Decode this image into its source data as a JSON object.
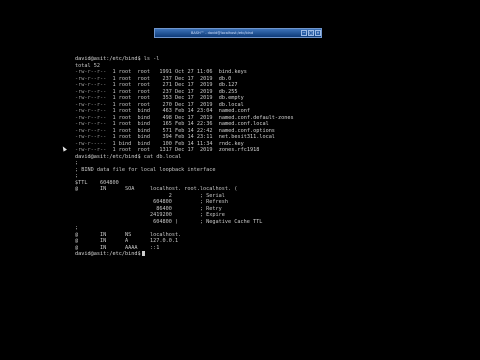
{
  "window": {
    "title": "BASH™ - david@localhost:/etc/bind",
    "controls": [
      "minimize",
      "maximize",
      "close"
    ]
  },
  "terminal": {
    "prompt": "david@asit:/etc/bind$",
    "cmd1": "ls -l",
    "total": "total 52",
    "ls": [
      {
        "perm": "-rw-r--r--",
        "links": "1",
        "owner": "root",
        "group": "root",
        "size": "1991",
        "date": "Oct 27 11:06",
        "name": "bind.keys"
      },
      {
        "perm": "-rw-r--r--",
        "links": "1",
        "owner": "root",
        "group": "root",
        "size": "237",
        "date": "Dec 17  2019",
        "name": "db.0"
      },
      {
        "perm": "-rw-r--r--",
        "links": "1",
        "owner": "root",
        "group": "root",
        "size": "271",
        "date": "Dec 17  2019",
        "name": "db.127"
      },
      {
        "perm": "-rw-r--r--",
        "links": "1",
        "owner": "root",
        "group": "root",
        "size": "237",
        "date": "Dec 17  2019",
        "name": "db.255"
      },
      {
        "perm": "-rw-r--r--",
        "links": "1",
        "owner": "root",
        "group": "root",
        "size": "353",
        "date": "Dec 17  2019",
        "name": "db.empty"
      },
      {
        "perm": "-rw-r--r--",
        "links": "1",
        "owner": "root",
        "group": "root",
        "size": "270",
        "date": "Dec 17  2019",
        "name": "db.local"
      },
      {
        "perm": "-rw-r--r--",
        "links": "1",
        "owner": "root",
        "group": "bind",
        "size": "463",
        "date": "Feb 14 23:04",
        "name": "named.conf"
      },
      {
        "perm": "-rw-r--r--",
        "links": "1",
        "owner": "root",
        "group": "bind",
        "size": "498",
        "date": "Dec 17  2019",
        "name": "named.conf.default-zones"
      },
      {
        "perm": "-rw-r--r--",
        "links": "1",
        "owner": "root",
        "group": "bind",
        "size": "165",
        "date": "Feb 14 22:36",
        "name": "named.conf.local"
      },
      {
        "perm": "-rw-r--r--",
        "links": "1",
        "owner": "root",
        "group": "bind",
        "size": "571",
        "date": "Feb 14 22:42",
        "name": "named.conf.options"
      },
      {
        "perm": "-rw-r--r--",
        "links": "1",
        "owner": "root",
        "group": "bind",
        "size": "394",
        "date": "Feb 14 23:11",
        "name": "net.besit311.local"
      },
      {
        "perm": "-rw-r-----",
        "links": "1",
        "owner": "bind",
        "group": "bind",
        "size": "100",
        "date": "Feb 14 11:34",
        "name": "rndc.key"
      },
      {
        "perm": "-rw-r--r--",
        "links": "1",
        "owner": "root",
        "group": "root",
        "size": "1317",
        "date": "Dec 17  2019",
        "name": "zones.rfc1918"
      }
    ],
    "cmd2": "cat db.local",
    "zone_lines": [
      ";",
      "; BIND data file for local loopback interface",
      ";",
      "$TTL    604800",
      "@       IN      SOA     localhost. root.localhost. (",
      "                              2         ; Serial",
      "                         604800         ; Refresh",
      "                          86400         ; Retry",
      "                        2419200         ; Expire",
      "                         604800 )       ; Negative Cache TTL",
      ";",
      "@       IN      NS      localhost.",
      "@       IN      A       127.0.0.1",
      "@       IN      AAAA    ::1"
    ]
  }
}
